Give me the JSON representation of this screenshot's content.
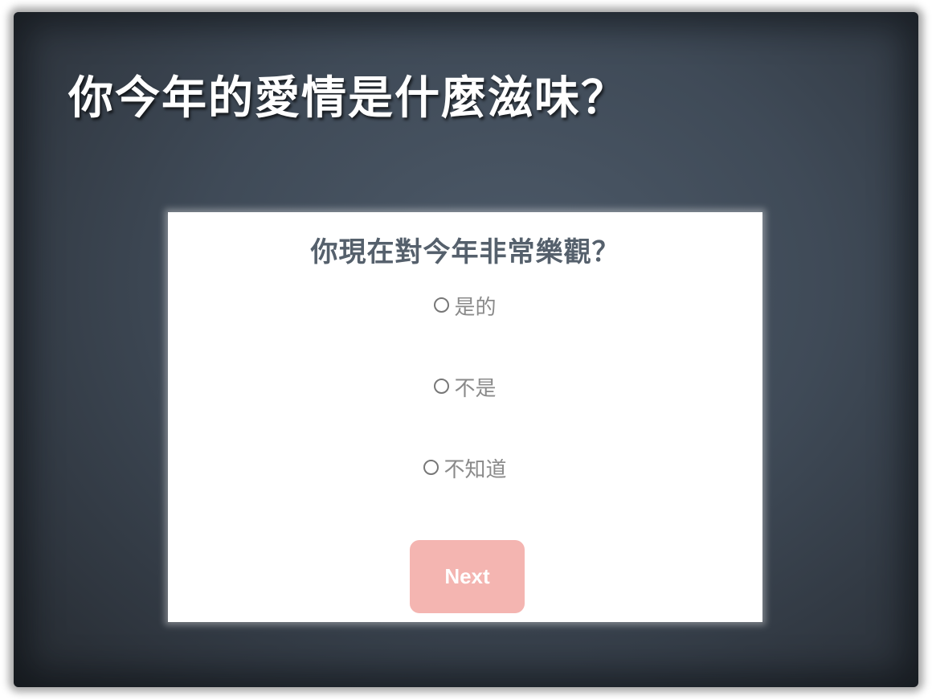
{
  "page": {
    "headline": "你今年的愛情是什麼滋味？"
  },
  "quiz": {
    "question": "你現在對今年非常樂觀？",
    "options": [
      {
        "label": "是的",
        "selected": false
      },
      {
        "label": "不是",
        "selected": false
      },
      {
        "label": "不知道",
        "selected": false
      }
    ],
    "next_label": "Next"
  },
  "colors": {
    "background": "#3f4a57",
    "card": "#ffffff",
    "question_text": "#55606c",
    "option_text": "#8a8a8a",
    "next_button": "#f4b5b1"
  },
  "icons": {
    "radio": "radio-unchecked-icon"
  }
}
